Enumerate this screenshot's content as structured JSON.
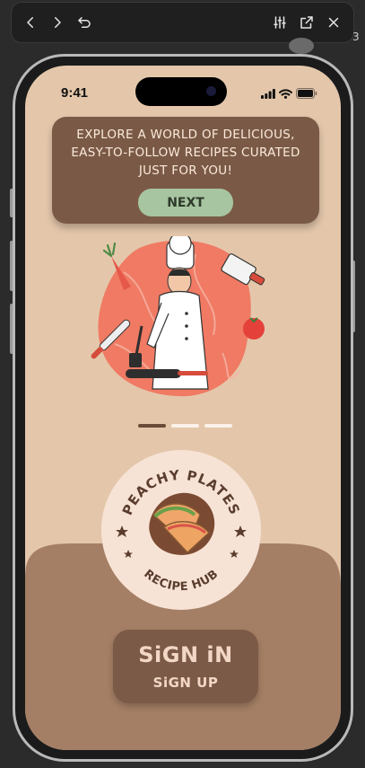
{
  "toolbar": {
    "back_icon": "chevron-left-icon",
    "forward_icon": "chevron-right-icon",
    "undo_icon": "undo-icon",
    "adjust_icon": "sliders-icon",
    "open_external_icon": "external-link-icon",
    "close_icon": "close-icon",
    "side_peek_text": "3"
  },
  "status_bar": {
    "time": "9:41",
    "icons": [
      "signal-icon",
      "wifi-icon",
      "battery-icon"
    ]
  },
  "onboarding": {
    "message": "Explore a world of delicious, easy-to-follow recipes curated just for you!",
    "next_label": "NEXT",
    "page_indicator": {
      "total": 3,
      "current": 1
    }
  },
  "logo": {
    "top_text": "PEACHY PLATES",
    "bottom_text": "RECIPE HUB"
  },
  "auth": {
    "sign_in_label": "SiGN iN",
    "sign_up_label": "SiGN UP"
  },
  "colors": {
    "background": "#e4c7ab",
    "card": "#7a5a46",
    "next_button": "#a7c5a0",
    "wave": "#a57f65",
    "logo_circle": "#f7e3d6",
    "chef_blob": "#f07a63"
  }
}
